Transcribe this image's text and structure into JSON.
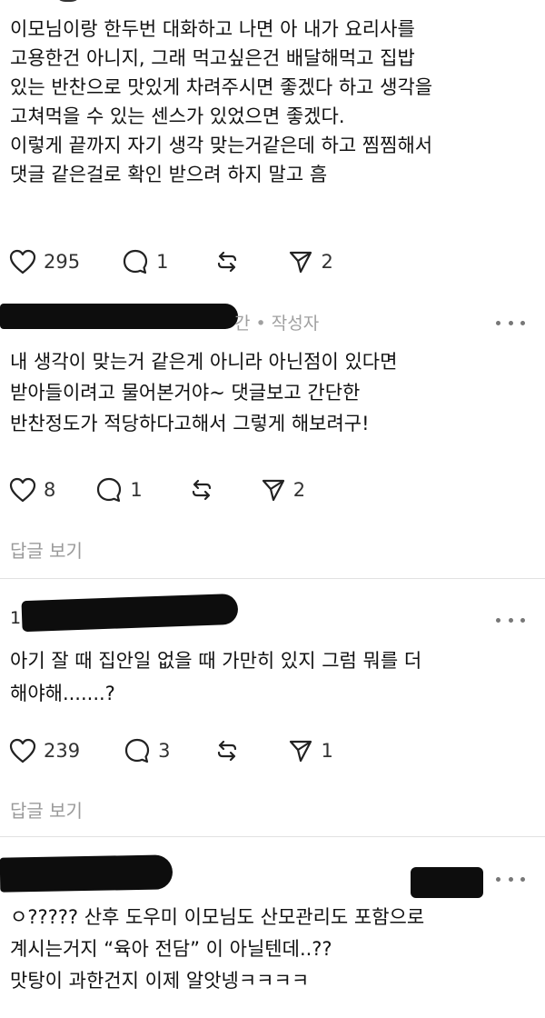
{
  "post1": {
    "lines": [
      "이모님이랑 한두번 대화하고 나면 아 내가 요리사를",
      "고용한건 아니지, 그래 먹고싶은건 배달해먹고 집밥",
      "있는 반찬으로 맛있게 차려주시면 좋겠다 하고 생각을",
      "고쳐먹을 수 있는 센스가 있었으면 좋겠다.",
      "이렇게 끝까지 자기 생각 맞는거같은데 하고 찜찜해서",
      "댓글 같은걸로 확인 받으려 하지 말고 흠"
    ],
    "likes": "295",
    "replies": "1",
    "reposts": "",
    "shares": "2"
  },
  "post2": {
    "meta_suffix": "간 • 작성자",
    "lines": [
      "내 생각이 맞는거 같은게 아니라 아닌점이 있다면",
      "받아들이려고 물어본거야~ 댓글보고 간단한",
      "반찬정도가 적당하다고해서 그렇게 해보려구!"
    ],
    "likes": "8",
    "replies": "1",
    "shares": "2",
    "view_replies": "답글 보기"
  },
  "post3": {
    "meta_prefix": "1",
    "lines": [
      "아기 잘 때 집안일 없을 때 가만히 있지 그럼 뭐를 더",
      "해야해.......?"
    ],
    "likes": "239",
    "replies": "3",
    "shares": "1",
    "view_replies": "답글 보기"
  },
  "post4": {
    "lines": [
      "ㅇ????? 산후 도우미 이모님도 산모관리도 포함으로",
      "계시는거지 “육아 전담” 이 아닐텐데..??",
      "맛탕이 과한건지 이제 알앗넹ㅋㅋㅋㅋ"
    ]
  },
  "icons": [
    "heart-icon",
    "comment-icon",
    "repost-icon",
    "share-icon",
    "more-icon"
  ],
  "colors": {
    "text": "#111111",
    "meta": "#a0a0a0",
    "divider": "#e1e1e1",
    "redaction": "#0d0d0d"
  }
}
